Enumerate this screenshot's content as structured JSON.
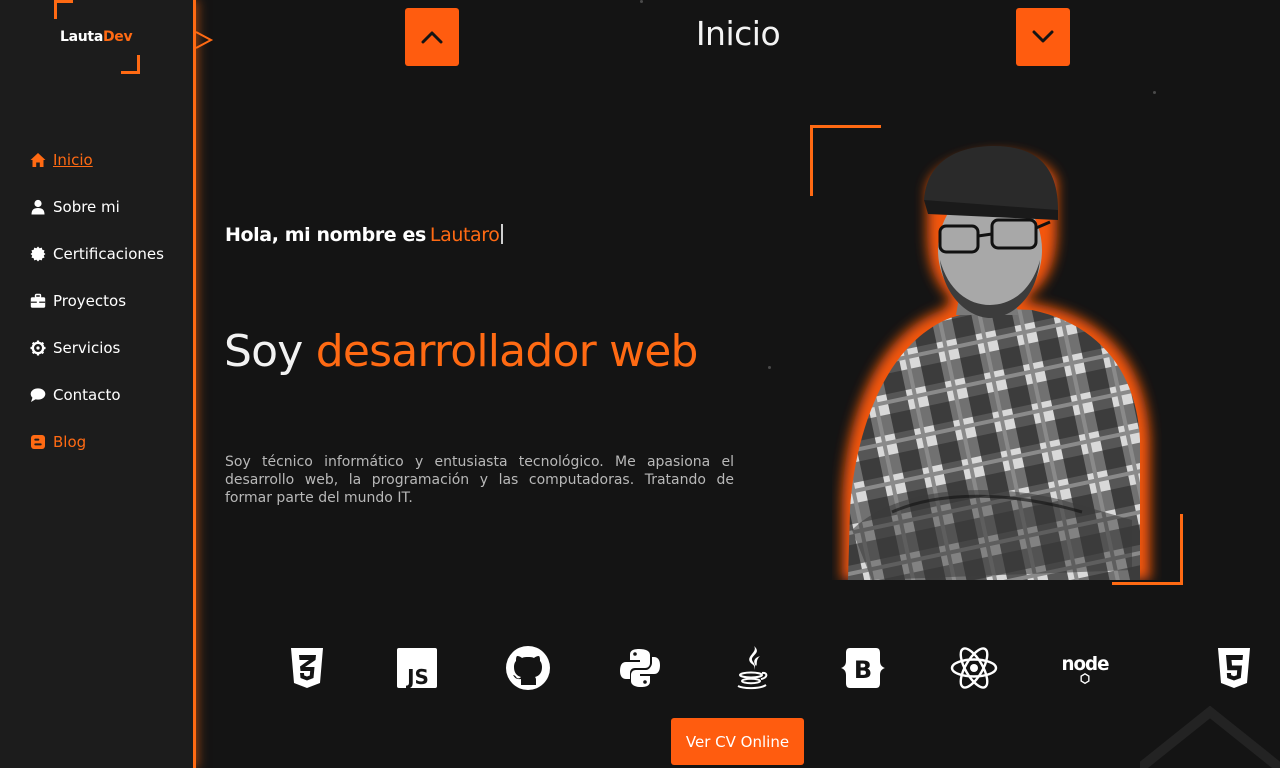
{
  "brand": {
    "logo_part1": "Lauta",
    "logo_part2": "Dev"
  },
  "sidebar": {
    "items": [
      {
        "label": "Inicio",
        "icon": "home-icon",
        "active": true
      },
      {
        "label": "Sobre mi",
        "icon": "user-icon"
      },
      {
        "label": "Certificaciones",
        "icon": "certificate-icon"
      },
      {
        "label": "Proyectos",
        "icon": "briefcase-icon"
      },
      {
        "label": "Servicios",
        "icon": "gear-icon"
      },
      {
        "label": "Contacto",
        "icon": "chat-icon"
      },
      {
        "label": "Blog",
        "icon": "blogger-icon",
        "accent": true
      }
    ],
    "toggle_icon": "chevron-right-icon"
  },
  "header": {
    "title": "Inicio",
    "prev_icon": "chevron-up-icon",
    "next_icon": "chevron-down-icon"
  },
  "hero": {
    "greeting": "Hola, mi nombre es",
    "name": "Lautaro",
    "headline_prefix": "Soy",
    "headline_highlight": "desarrollador web",
    "about": "Soy técnico informático y entusiasta tecnológico. Me apasiona el desarrollo web, la programación y las computadoras. Tratando de formar parte del mundo IT."
  },
  "tech_icons": [
    "css3-icon",
    "javascript-icon",
    "github-icon",
    "python-icon",
    "java-icon",
    "bootstrap-icon",
    "react-icon",
    "nodejs-icon",
    "html5-icon"
  ],
  "node_label": "node",
  "cv_button": "Ver CV Online",
  "colors": {
    "accent": "#ff6a13",
    "button": "#ff5c0f",
    "background": "#141414",
    "sidebar": "#1c1c1c"
  }
}
